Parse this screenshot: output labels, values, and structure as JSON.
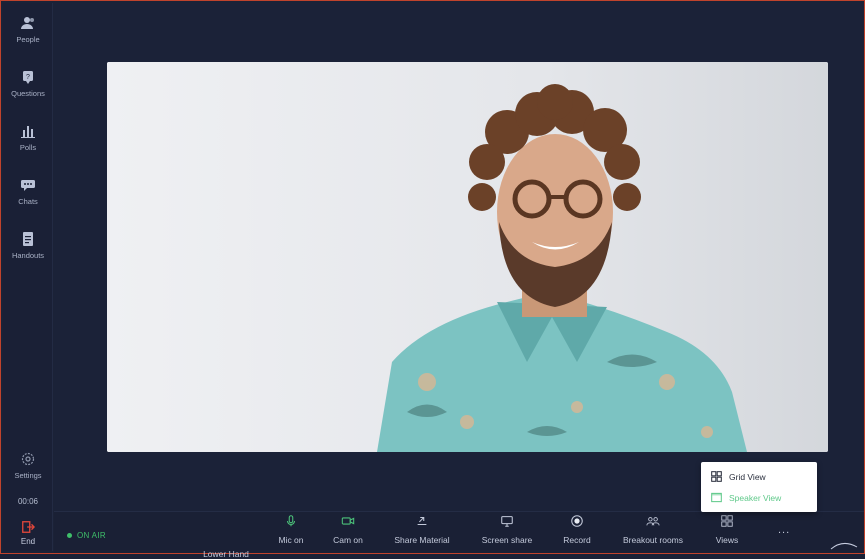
{
  "sidebar": {
    "items": [
      {
        "label": "People",
        "icon": "people-icon"
      },
      {
        "label": "Questions",
        "icon": "question-icon"
      },
      {
        "label": "Polls",
        "icon": "polls-icon"
      },
      {
        "label": "Chats",
        "icon": "chat-icon"
      },
      {
        "label": "Handouts",
        "icon": "handout-icon"
      }
    ],
    "settings_label": "Settings",
    "timer": "00:06",
    "end_label": "End"
  },
  "status": {
    "on_air": "ON AIR"
  },
  "controls": [
    {
      "label": "Lower Hand",
      "icon": "hand-icon"
    },
    {
      "label": "Mic on",
      "icon": "mic-icon"
    },
    {
      "label": "Cam on",
      "icon": "camera-icon"
    },
    {
      "label": "Share Material",
      "icon": "share-material-icon"
    },
    {
      "label": "Screen share",
      "icon": "screen-share-icon"
    },
    {
      "label": "Record",
      "icon": "record-icon"
    },
    {
      "label": "Breakout rooms",
      "icon": "breakout-rooms-icon"
    },
    {
      "label": "Views",
      "icon": "views-icon"
    }
  ],
  "more_label": "...",
  "views_menu": {
    "options": [
      {
        "label": "Grid View",
        "icon": "grid-view-icon"
      },
      {
        "label": "Speaker View",
        "icon": "speaker-view-icon"
      }
    ]
  },
  "colors": {
    "accent_green": "#4cc27a",
    "end_red": "#e2473b",
    "background": "#1b2237"
  }
}
